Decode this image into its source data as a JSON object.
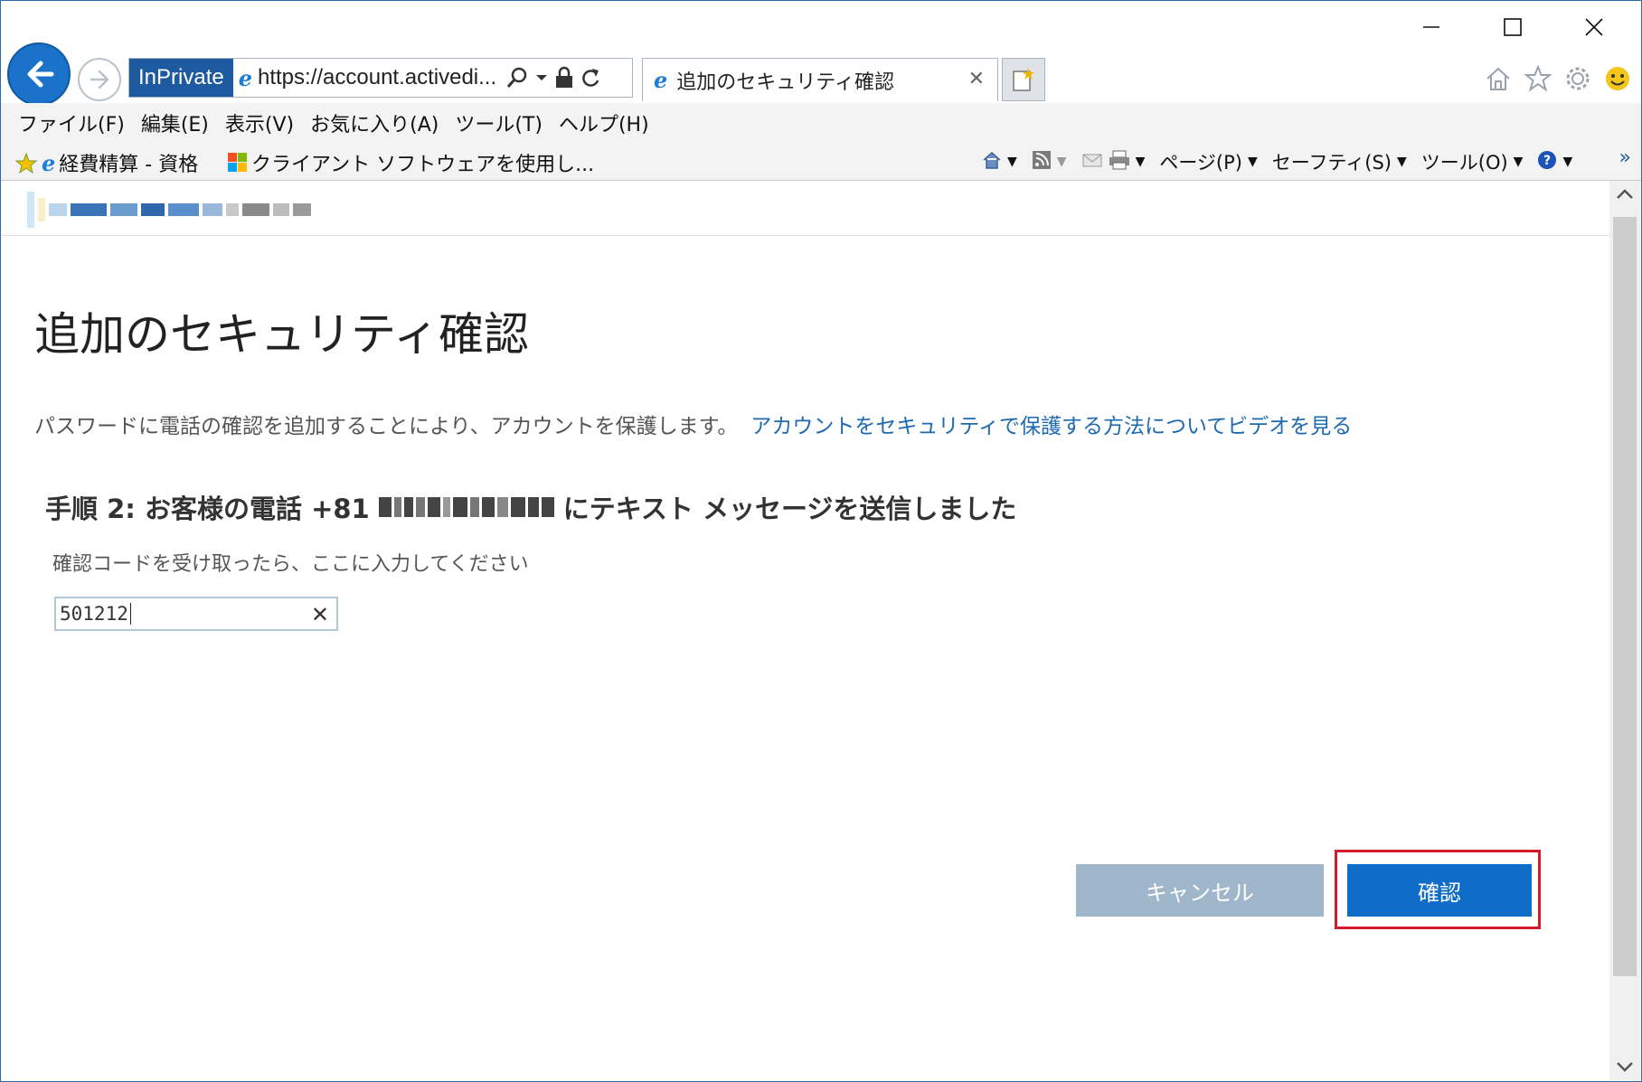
{
  "window": {
    "controls": [
      "minimize",
      "maximize",
      "close"
    ]
  },
  "browser": {
    "inprivate_label": "InPrivate",
    "url": "https://account.activedi...",
    "tab_title": "追加のセキュリティ確認",
    "tab_close": "✕"
  },
  "menu": {
    "items": [
      "ファイル(F)",
      "編集(E)",
      "表示(V)",
      "お気に入り(A)",
      "ツール(T)",
      "ヘルプ(H)"
    ]
  },
  "favorites": {
    "items": [
      "経費精算 - 資格",
      "クライアント ソフトウェアを使用し..."
    ]
  },
  "commandbar": {
    "page": "ページ(P)",
    "safety": "セーフティ(S)",
    "tools": "ツール(O)",
    "overflow": "»"
  },
  "page": {
    "title": "追加のセキュリティ確認",
    "description": "パスワードに電話の確認を追加することにより、アカウントを保護します。",
    "video_link": "アカウントをセキュリティで保護する方法についてビデオを見る",
    "step_prefix": "手順 2: お客様の電話 +81",
    "step_suffix": "にテキスト メッセージを送信しました",
    "hint": "確認コードを受け取ったら、ここに入力してください",
    "code_value": "501212",
    "clear_label": "✕",
    "cancel_button": "キャンセル",
    "confirm_button": "確認"
  },
  "colors": {
    "accent": "#0f6cc8",
    "link": "#1e6ab0",
    "cancel": "#a0b6cb",
    "highlight": "#d21a2a"
  }
}
